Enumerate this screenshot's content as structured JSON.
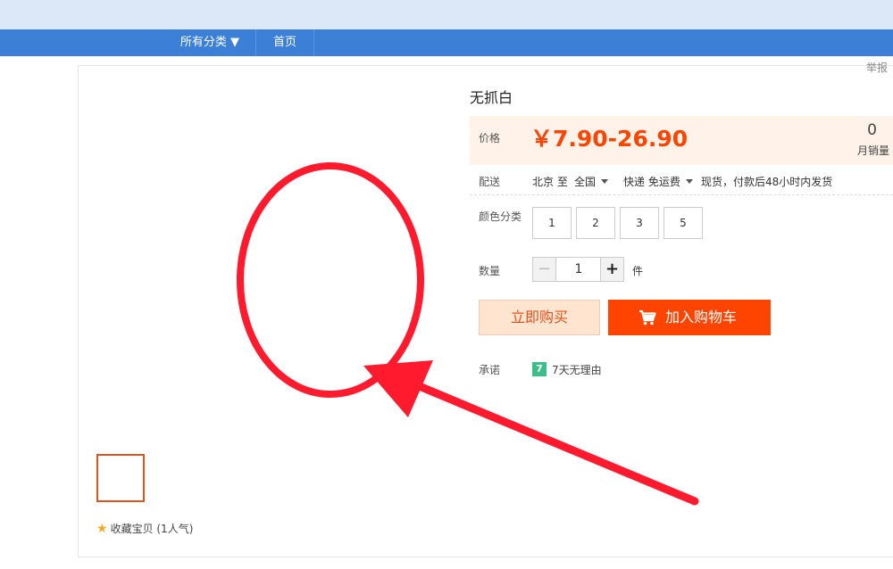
{
  "nav": {
    "all_categories": "所有分类 ▼",
    "home": "首页"
  },
  "report": "举报",
  "product": {
    "title": "无抓白"
  },
  "price": {
    "label": "价格",
    "value": "￥7.90-26.90",
    "sales_count": "0",
    "sales_label": "月销量"
  },
  "shipping": {
    "label": "配送",
    "from": "北京 至",
    "to": "全国",
    "method": "快递 免运费",
    "note": "现货，付款后48小时内发货"
  },
  "sku": {
    "label": "颜色分类",
    "options": [
      "1",
      "2",
      "3",
      "5"
    ]
  },
  "quantity": {
    "label": "数量",
    "minus": "−",
    "value": "1",
    "plus": "+",
    "unit": "件"
  },
  "actions": {
    "buy_now": "立即购买",
    "add_to_cart": "加入购物车"
  },
  "promise": {
    "label": "承诺",
    "icon_text": "7",
    "text": "7天无理由"
  },
  "favorite": {
    "text": "收藏宝贝 (1人气)"
  },
  "colors": {
    "brand_blue": "#3c7fd6",
    "price_orange": "#ff4400",
    "annotation_red": "#ff1a2e"
  }
}
